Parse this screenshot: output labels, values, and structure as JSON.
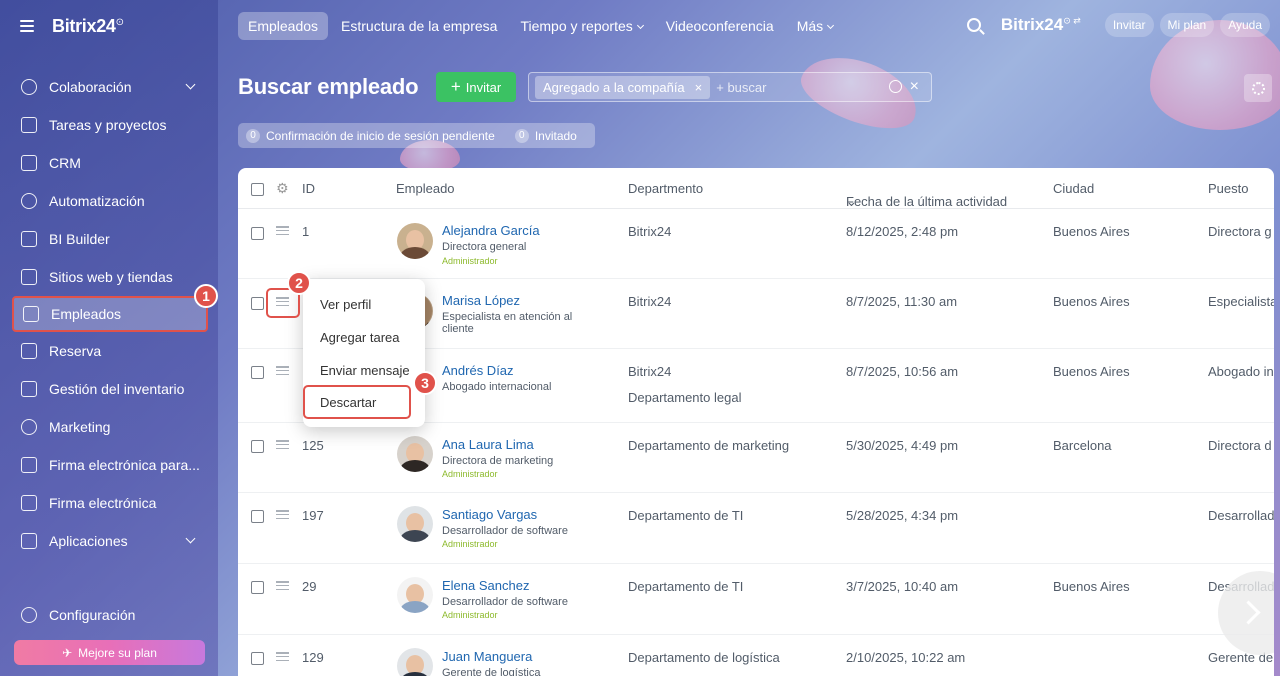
{
  "sidebar": {
    "brand": "Bitrix24",
    "items": [
      {
        "label": "Colaboración",
        "icon": "chat-icon",
        "expand": true
      },
      {
        "label": "Tareas y proyectos",
        "icon": "checkbox-icon"
      },
      {
        "label": "CRM",
        "icon": "crm-icon"
      },
      {
        "label": "Automatización",
        "icon": "robot-icon"
      },
      {
        "label": "BI Builder",
        "icon": "chart-icon"
      },
      {
        "label": "Sitios web y tiendas",
        "icon": "cart-icon"
      },
      {
        "label": "Empleados",
        "icon": "id-card-icon",
        "active": true
      },
      {
        "label": "Reserva",
        "icon": "calendar-icon"
      },
      {
        "label": "Gestión del inventario",
        "icon": "warehouse-icon"
      },
      {
        "label": "Marketing",
        "icon": "target-icon"
      },
      {
        "label": "Firma electrónica para...",
        "icon": "document-sign-icon"
      },
      {
        "label": "Firma electrónica",
        "icon": "pen-icon"
      },
      {
        "label": "Aplicaciones",
        "icon": "cube-icon",
        "expand": true
      }
    ],
    "config": "Configuración",
    "upgrade": "Mejore su plan"
  },
  "topnav": {
    "tabs": [
      "Empleados",
      "Estructura de la empresa",
      "Tiempo y reportes",
      "Videoconferencia",
      "Más"
    ],
    "brand": "Bitrix24",
    "invite": "Invitar",
    "plan": "Mi plan",
    "help": "Ayuda"
  },
  "page": {
    "title": "Buscar empleado",
    "invite_btn": "Invitar",
    "filter_chip": "Agregado a la compañía",
    "filter_placeholder": "+ buscar",
    "counter1_num": "0",
    "counter1_label": "Confirmación de inicio de sesión pendiente",
    "counter2_num": "0",
    "counter2_label": "Invitado"
  },
  "table": {
    "headers": {
      "id": "ID",
      "employee": "Empleado",
      "department": "Departmento",
      "activity": "Fecha de la última actividad",
      "city": "Ciudad",
      "position": "Puesto"
    },
    "rows": [
      {
        "id": "1",
        "name": "Alejandra García",
        "role": "Directora general",
        "admin": "Administrador",
        "dept": "Bitrix24",
        "dept2": "",
        "date": "8/12/2025, 2:48 pm",
        "city": "Buenos Aires",
        "position": "Directora g"
      },
      {
        "id": "",
        "name": "Marisa López",
        "role": "Especialista en atención al cliente",
        "admin": "",
        "dept": "Bitrix24",
        "dept2": "",
        "date": "8/7/2025, 11:30 am",
        "city": "Buenos Aires",
        "position": "Especialista"
      },
      {
        "id": "",
        "name": "Andrés Díaz",
        "role": "Abogado internacional",
        "admin": "",
        "dept": "Bitrix24",
        "dept2": "Departamento legal",
        "date": "8/7/2025, 10:56 am",
        "city": "Buenos Aires",
        "position": "Abogado in"
      },
      {
        "id": "125",
        "name": "Ana Laura Lima",
        "role": "Directora de marketing",
        "admin": "Administrador",
        "dept": "Departamento de marketing",
        "dept2": "",
        "date": "5/30/2025, 4:49 pm",
        "city": "Barcelona",
        "position": "Directora d"
      },
      {
        "id": "197",
        "name": "Santiago Vargas",
        "role": "Desarrollador de software",
        "admin": "Administrador",
        "dept": "Departamento de TI",
        "dept2": "",
        "date": "5/28/2025, 4:34 pm",
        "city": "",
        "position": "Desarrollad"
      },
      {
        "id": "29",
        "name": "Elena Sanchez",
        "role": "Desarrollador de software",
        "admin": "Administrador",
        "dept": "Departamento de TI",
        "dept2": "",
        "date": "3/7/2025, 10:40 am",
        "city": "Buenos Aires",
        "position": "Desarrollad"
      },
      {
        "id": "129",
        "name": "Juan Manguera",
        "role": "Gerente de logística",
        "admin": "",
        "dept": "Departamento de logística",
        "dept2": "",
        "date": "2/10/2025, 10:22 am",
        "city": "",
        "position": "Gerente de"
      }
    ]
  },
  "context_menu": {
    "items": [
      "Ver perfil",
      "Agregar tarea",
      "Enviar mensaje",
      "Descartar"
    ]
  },
  "markers": [
    "1",
    "2",
    "3"
  ]
}
